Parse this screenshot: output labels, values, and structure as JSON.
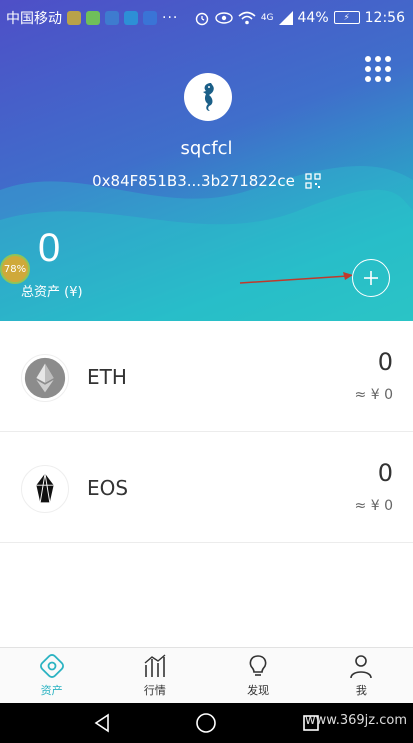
{
  "status_bar": {
    "carrier": "中国移动",
    "more": "···",
    "network": "4G",
    "battery": "44%",
    "time": "12:56"
  },
  "wallet": {
    "name": "sqcfcl",
    "address": "0x84F851B3...3b271822ce",
    "total_assets": "0",
    "total_assets_label": "总资产 (¥)",
    "progress_badge": "78%"
  },
  "assets": [
    {
      "symbol": "ETH",
      "amount": "0",
      "fiat": "≈ ¥ 0",
      "icon": "ethereum-icon"
    },
    {
      "symbol": "EOS",
      "amount": "0",
      "fiat": "≈ ¥ 0",
      "icon": "eos-icon"
    }
  ],
  "bottom_nav": [
    {
      "label": "资产",
      "icon": "wallet-icon",
      "active": true
    },
    {
      "label": "行情",
      "icon": "market-chart-icon",
      "active": false
    },
    {
      "label": "发现",
      "icon": "lightbulb-icon",
      "active": false
    },
    {
      "label": "我",
      "icon": "profile-icon",
      "active": false
    }
  ],
  "watermark": "www.369jz.com",
  "colors": {
    "header_start": "#4e4fc7",
    "header_end": "#2cc3c0",
    "accent": "#2bb3c2",
    "annotation_arrow": "#c0392b"
  }
}
